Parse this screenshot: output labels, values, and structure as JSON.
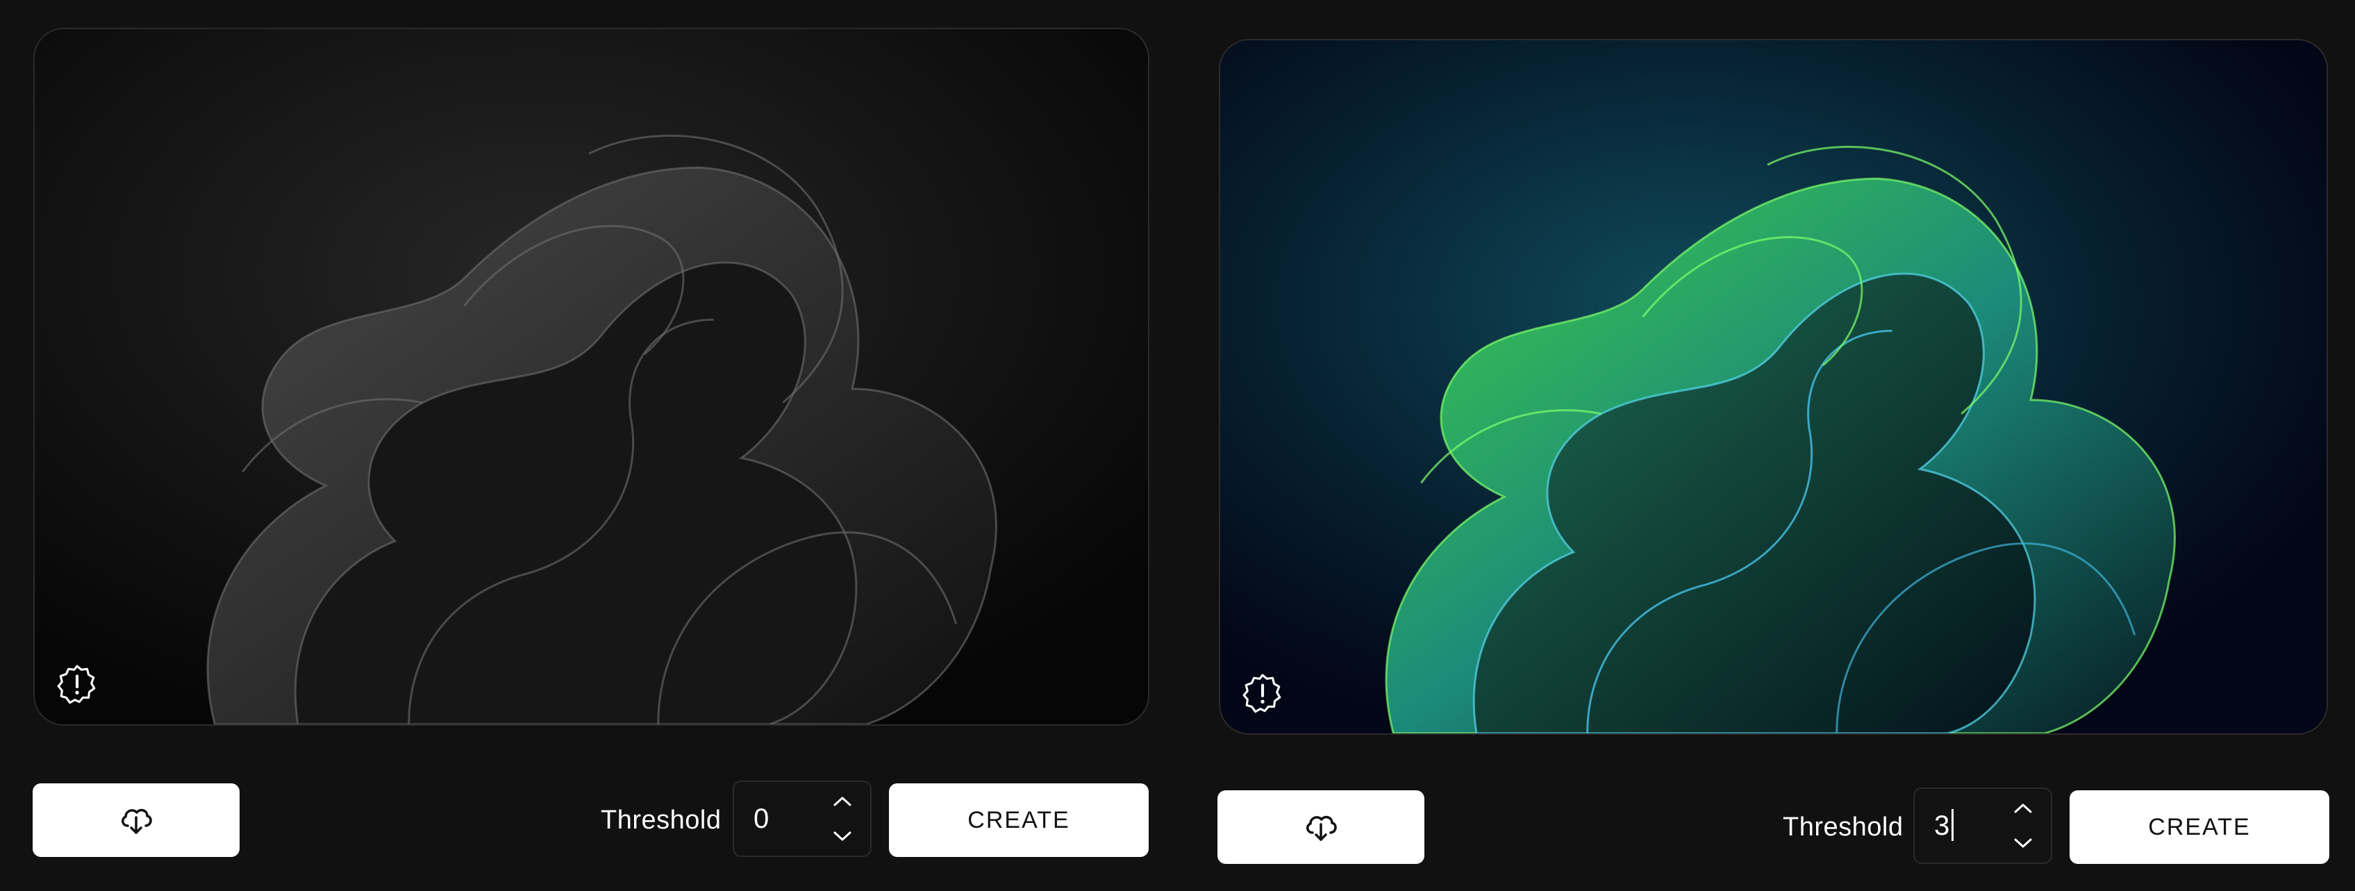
{
  "panels": [
    {
      "id": "grayscale",
      "accent": "#9a9a9a",
      "threshold_label": "Threshold",
      "threshold_value": "0",
      "create_label": "CREATE",
      "icons": {
        "download": "cloud-download-icon",
        "warning": "badge-alert-icon",
        "up": "chevron-up-icon",
        "down": "chevron-down-icon"
      }
    },
    {
      "id": "colored",
      "accent": "#5fe04a",
      "accent_secondary": "#3fb4d8",
      "threshold_label": "Threshold",
      "threshold_value": "3",
      "create_label": "CREATE",
      "icons": {
        "download": "cloud-download-icon",
        "warning": "badge-alert-icon",
        "up": "chevron-up-icon",
        "down": "chevron-down-icon"
      }
    }
  ]
}
